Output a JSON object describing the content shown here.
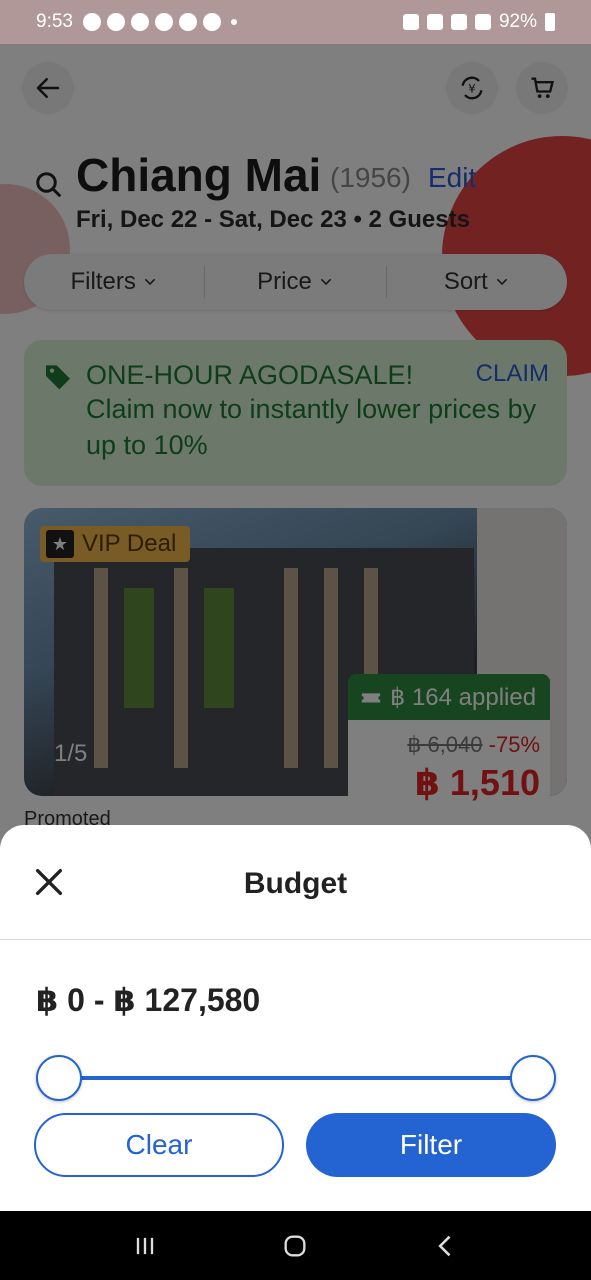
{
  "status_bar": {
    "time": "9:53",
    "battery": "92%"
  },
  "header": {
    "city": "Chiang Mai",
    "count": "(1956)",
    "edit_label": "Edit",
    "dates": "Fri, Dec 22 - Sat, Dec 23 • 2 Guests"
  },
  "filter_bar": {
    "filters_label": "Filters",
    "price_label": "Price",
    "sort_label": "Sort"
  },
  "promo": {
    "title": "ONE-HOUR AGODASALE!",
    "text": "Claim now to instantly lower prices by up to 10%",
    "claim_label": "CLAIM"
  },
  "hotel_card": {
    "badge": "VIP Deal",
    "pager": "1/5",
    "applied": "฿ 164 applied",
    "old_price": "฿ 6,040",
    "discount": "-75%",
    "price": "฿ 1,510",
    "promoted": "Promoted"
  },
  "sheet": {
    "title": "Budget",
    "range": "฿ 0 - ฿ 127,580",
    "slider_min_fraction": 0,
    "slider_max_fraction": 1,
    "clear_label": "Clear",
    "filter_label": "Filter"
  },
  "colors": {
    "accent": "#2364d2",
    "promo_green": "#1f7a35",
    "price_red": "#e12424"
  }
}
